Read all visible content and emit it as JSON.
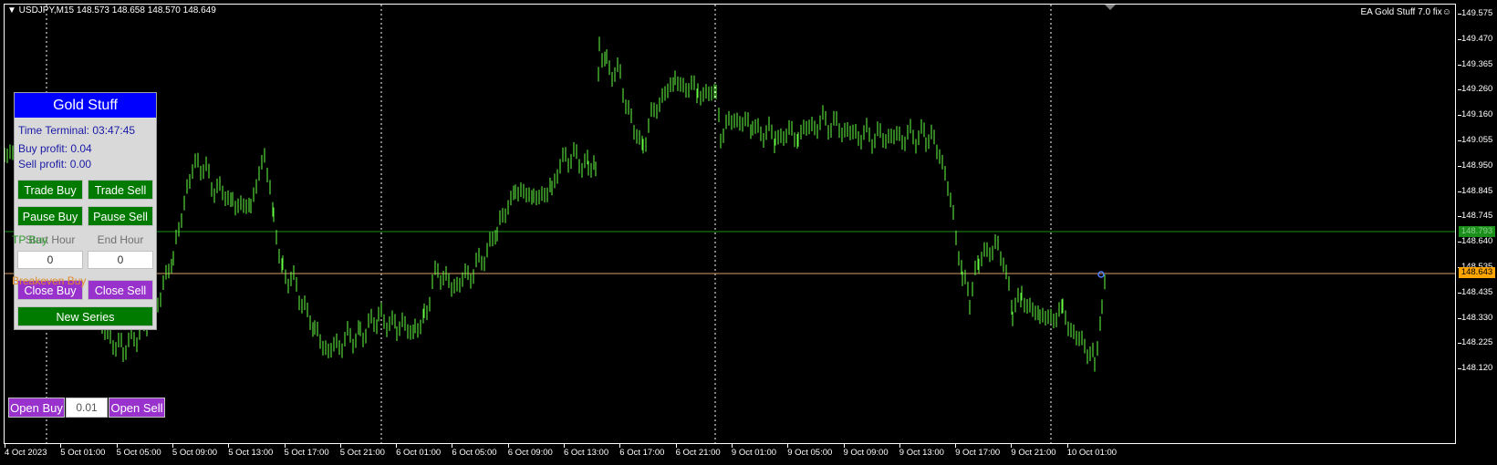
{
  "header": {
    "symbol_info": "▼ USDJPY,M15  148.573 148.658 148.570 148.649",
    "ea_label": "EA Gold Stuff 7.0 fix☺"
  },
  "price_scale": {
    "labels": [
      "149.575",
      "149.470",
      "149.365",
      "149.260",
      "149.160",
      "149.055",
      "148.950",
      "148.845",
      "148.745",
      "148.640",
      "148.535",
      "148.435",
      "148.330",
      "148.225",
      "148.120"
    ],
    "tp_tag": "148.793",
    "current_tag": "148.643"
  },
  "colors": {
    "candle": "#66ff44",
    "tp_line": "#1a8f1a",
    "bid_line": "#d9a066",
    "tp_tag_bg": "#1a8f1a",
    "current_tag_bg": "#ffa500",
    "panel_title_bg": "#0000ff",
    "button_green": "#007b00",
    "button_purple": "#9932cc"
  },
  "time_axis": {
    "labels": [
      "4 Oct 2023",
      "5 Oct 01:00",
      "5 Oct 05:00",
      "5 Oct 09:00",
      "5 Oct 13:00",
      "5 Oct 17:00",
      "5 Oct 21:00",
      "6 Oct 01:00",
      "6 Oct 05:00",
      "6 Oct 09:00",
      "6 Oct 13:00",
      "6 Oct 17:00",
      "6 Oct 21:00",
      "9 Oct 01:00",
      "9 Oct 05:00",
      "9 Oct 09:00",
      "9 Oct 13:00",
      "9 Oct 17:00",
      "9 Oct 21:00",
      "10 Oct 01:00"
    ]
  },
  "panel": {
    "title": "Gold Stuff",
    "time_terminal": "Time Terminal: 03:47:45",
    "buy_profit": "Buy profit: 0.04",
    "sell_profit": "Sell profit: 0.00",
    "trade_buy": "Trade Buy",
    "trade_sell": "Trade Sell",
    "pause_buy": "Pause Buy",
    "pause_sell": "Pause Sell",
    "start_hour_label": "Start Hour",
    "end_hour_label": "End Hour",
    "start_hour_value": "0",
    "end_hour_value": "0",
    "close_buy": "Close Buy",
    "close_sell": "Close Sell",
    "new_series": "New Series"
  },
  "chart_lines": {
    "tp_buy_label": "TP Buy",
    "breakeven_buy_label": "Breakeven Buy"
  },
  "trade_bar": {
    "open_buy": "Open Buy",
    "lot": "0.01",
    "open_sell": "Open Sell"
  }
}
